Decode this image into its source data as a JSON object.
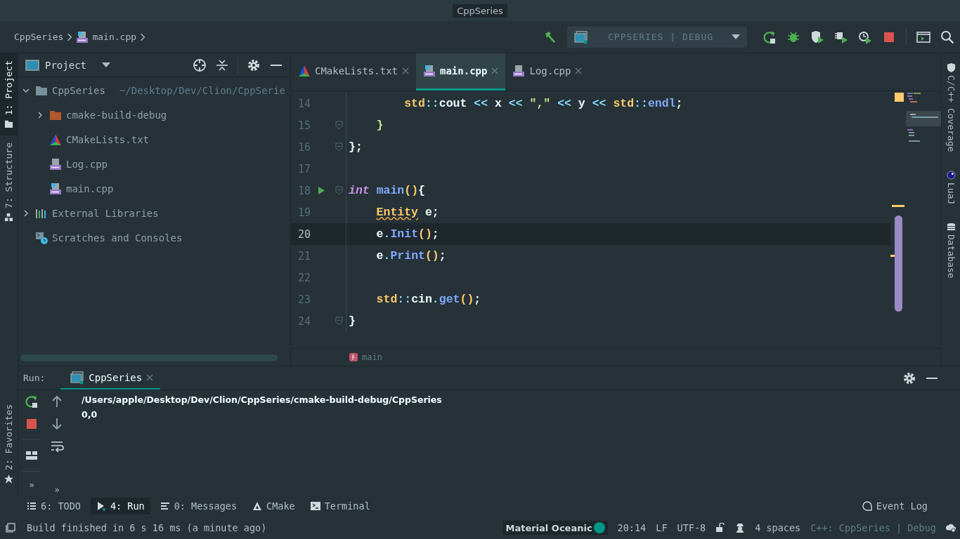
{
  "window": {
    "title": "CppSeries"
  },
  "breadcrumbs": [
    {
      "label": "CppSeries",
      "kind": "text"
    },
    {
      "label": "main.cpp",
      "kind": "cpp-main"
    }
  ],
  "run_config": {
    "label": "CPPSERIES | DEBUG"
  },
  "left_strip": [
    {
      "label": "1: Project",
      "kind": "project",
      "selected": true
    },
    {
      "label": "7: Structure",
      "kind": "structure",
      "selected": false
    }
  ],
  "left_strip_bottom": [
    {
      "label": "2: Favorites",
      "kind": "favorites",
      "selected": false
    }
  ],
  "project_panel": {
    "title": "Project",
    "tree": [
      {
        "label": "CppSeries",
        "path": "~/Desktop/Dev/Clion/CppSerie",
        "kind": "folder",
        "expanded": true,
        "children": [
          {
            "label": "cmake-build-debug",
            "kind": "build-folder",
            "expanded": false
          },
          {
            "label": "CMakeLists.txt",
            "kind": "cmake"
          },
          {
            "label": "Log.cpp",
            "kind": "cpp"
          },
          {
            "label": "main.cpp",
            "kind": "cpp-main"
          }
        ]
      },
      {
        "label": "External Libraries",
        "kind": "libraries",
        "expanded": false
      },
      {
        "label": "Scratches and Consoles",
        "kind": "scratches"
      }
    ]
  },
  "editor": {
    "tabs": [
      {
        "label": "CMakeLists.txt",
        "kind": "cmake",
        "selected": false
      },
      {
        "label": "main.cpp",
        "kind": "cpp-main",
        "selected": true
      },
      {
        "label": "Log.cpp",
        "kind": "cpp",
        "selected": false
      }
    ],
    "lines": [
      {
        "number": "14",
        "run": false,
        "fold": false,
        "current": false,
        "tokens": [
          {
            "text": "        std",
            "kind": "namespace"
          },
          {
            "text": "::",
            "kind": "operator"
          },
          {
            "text": "cout ",
            "kind": "plain"
          },
          {
            "text": "<<",
            "kind": "operator"
          },
          {
            "text": " x ",
            "kind": "plain"
          },
          {
            "text": "<<",
            "kind": "operator"
          },
          {
            "text": " \",\" ",
            "kind": "string"
          },
          {
            "text": "<<",
            "kind": "operator"
          },
          {
            "text": " y ",
            "kind": "plain"
          },
          {
            "text": "<<",
            "kind": "operator"
          },
          {
            "text": " std",
            "kind": "namespace"
          },
          {
            "text": "::",
            "kind": "operator"
          },
          {
            "text": "endl",
            "kind": "function"
          },
          {
            "text": ";",
            "kind": "plain"
          }
        ]
      },
      {
        "number": "15",
        "run": false,
        "fold": true,
        "current": false,
        "tokens": [
          {
            "text": "    }",
            "kind": "bracket-alt"
          }
        ]
      },
      {
        "number": "16",
        "run": false,
        "fold": true,
        "current": false,
        "tokens": [
          {
            "text": "};",
            "kind": "plain"
          }
        ]
      },
      {
        "number": "17",
        "run": false,
        "fold": false,
        "current": false
      },
      {
        "number": "18",
        "run": true,
        "fold": true,
        "current": false,
        "tokens": [
          {
            "text": "int",
            "kind": "keyword"
          },
          {
            "text": " main",
            "kind": "function"
          },
          {
            "text": "()",
            "kind": "bracket"
          },
          {
            "text": "{",
            "kind": "plain"
          }
        ]
      },
      {
        "number": "19",
        "run": false,
        "fold": false,
        "current": false,
        "tokens": [
          {
            "text": "    Entity",
            "kind": "type-warning"
          },
          {
            "text": " e;",
            "kind": "plain"
          }
        ]
      },
      {
        "number": "20",
        "run": false,
        "fold": false,
        "current": true,
        "tokens": [
          {
            "text": "    e",
            "kind": "plain"
          },
          {
            "text": ".",
            "kind": "operator"
          },
          {
            "text": "Init",
            "kind": "function"
          },
          {
            "text": "()",
            "kind": "bracket"
          },
          {
            "text": ";",
            "kind": "plain"
          }
        ]
      },
      {
        "number": "21",
        "run": false,
        "fold": false,
        "current": false,
        "tokens": [
          {
            "text": "    e",
            "kind": "plain"
          },
          {
            "text": ".",
            "kind": "operator"
          },
          {
            "text": "Print",
            "kind": "function"
          },
          {
            "text": "()",
            "kind": "bracket"
          },
          {
            "text": ";",
            "kind": "plain"
          }
        ]
      },
      {
        "number": "22",
        "run": false,
        "fold": false,
        "current": false
      },
      {
        "number": "23",
        "run": false,
        "fold": false,
        "current": false,
        "tokens": [
          {
            "text": "    std",
            "kind": "namespace"
          },
          {
            "text": "::",
            "kind": "operator"
          },
          {
            "text": "cin",
            "kind": "plain"
          },
          {
            "text": ".",
            "kind": "operator"
          },
          {
            "text": "get",
            "kind": "function"
          },
          {
            "text": "()",
            "kind": "bracket"
          },
          {
            "text": ";",
            "kind": "plain"
          }
        ]
      },
      {
        "number": "24",
        "run": false,
        "fold": true,
        "current": false,
        "tokens": [
          {
            "text": "}",
            "kind": "plain"
          }
        ]
      }
    ],
    "footer_crumb": "main"
  },
  "right_strip": [
    {
      "label": "C/C++ Coverage",
      "kind": "shield"
    },
    {
      "label": "LuaJ",
      "kind": "lua"
    },
    {
      "label": "Database",
      "kind": "database"
    }
  ],
  "run_panel": {
    "title": "Run:",
    "tabs": [
      {
        "label": "CppSeries",
        "selected": true
      }
    ],
    "output": [
      "/Users/apple/Desktop/Dev/Clion/CppSeries/cmake-build-debug/CppSeries",
      "0,0"
    ],
    "more": [
      "»",
      "»"
    ]
  },
  "tool_windows": [
    {
      "label": "6: TODO",
      "kind": "todo",
      "selected": false
    },
    {
      "label": "4: Run",
      "kind": "run",
      "selected": true
    },
    {
      "label": "0: Messages",
      "kind": "messages",
      "selected": false
    },
    {
      "label": "CMake",
      "kind": "cmake",
      "selected": false
    },
    {
      "label": "Terminal",
      "kind": "terminal",
      "selected": false
    }
  ],
  "event_log": "Event Log",
  "status_bar": {
    "message": "Build finished in 6 s 16 ms (a minute ago)",
    "theme": "Material Oceanic",
    "position": "20:14",
    "line_separator": "LF",
    "encoding": "UTF-8",
    "indent": "4 spaces",
    "context": "C++: CppSeries | Debug"
  }
}
